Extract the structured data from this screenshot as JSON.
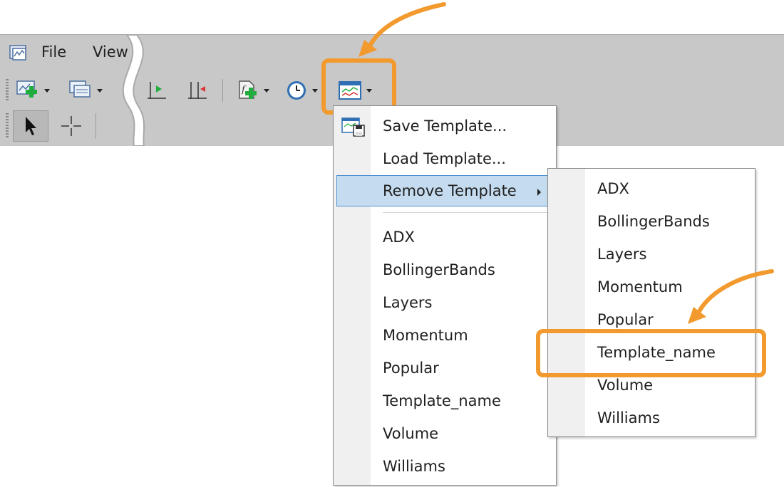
{
  "menubar": {
    "file": "File",
    "view": "View"
  },
  "toolbar": {
    "icons": [
      "new-chart-icon",
      "profiles-icon",
      "chart-shift-icon",
      "autoscroll-icon",
      "indicators-icon",
      "periods-icon",
      "templates-icon"
    ],
    "row2_icons": [
      "cursor-icon",
      "crosshair-icon"
    ]
  },
  "templates_menu": {
    "save": "Save Template...",
    "load": "Load Template...",
    "remove": "Remove Template",
    "items": [
      "ADX",
      "BollingerBands",
      "Layers",
      "Momentum",
      "Popular",
      "Template_name",
      "Volume",
      "Williams"
    ]
  },
  "remove_submenu": {
    "items": [
      "ADX",
      "BollingerBands",
      "Layers",
      "Momentum",
      "Popular",
      "Template_name",
      "Volume",
      "Williams"
    ],
    "highlighted": "Template_name"
  },
  "colors": {
    "annotation": "#f29a2e",
    "selection": "#c5dcf0",
    "toolbar": "#c8c8c8"
  }
}
